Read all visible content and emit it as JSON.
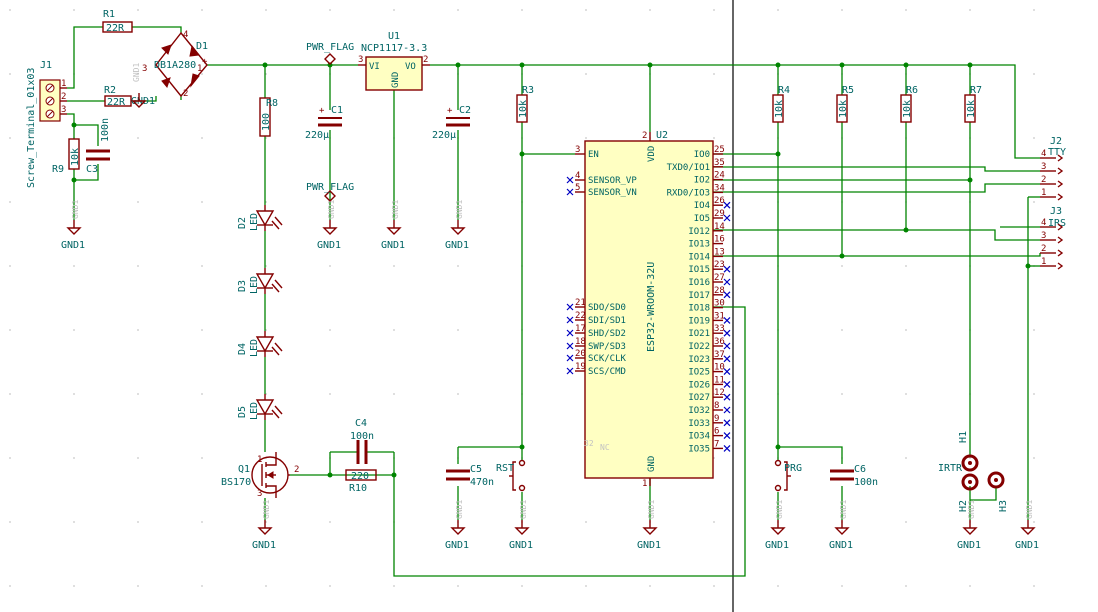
{
  "components": {
    "J1": {
      "ref": "J1",
      "value": "Screw_Terminal_01x03",
      "pins": [
        "1",
        "2",
        "3"
      ]
    },
    "R1": {
      "ref": "R1",
      "value": "22R"
    },
    "R2": {
      "ref": "R2",
      "value": "22R"
    },
    "D1": {
      "ref": "D1",
      "value": "DB1A280"
    },
    "R9": {
      "ref": "R9",
      "value": "10k"
    },
    "C3": {
      "ref": "C3",
      "value": "100n"
    },
    "R8": {
      "ref": "R8",
      "value": "100"
    },
    "C1": {
      "ref": "C1",
      "value": "220µ"
    },
    "U1": {
      "ref": "U1",
      "value": "NCP1117-3.3",
      "pin_vi": "VI",
      "pin_vo": "VO",
      "pin_gnd": "GND",
      "num_3": "3",
      "num_2": "2",
      "num_1": "1"
    },
    "C2": {
      "ref": "C2",
      "value": "220µ"
    },
    "R3": {
      "ref": "R3",
      "value": "10k"
    },
    "R4": {
      "ref": "R4",
      "value": "10k"
    },
    "R5": {
      "ref": "R5",
      "value": "10k"
    },
    "R6": {
      "ref": "R6",
      "value": "10k"
    },
    "R7": {
      "ref": "R7",
      "value": "10k"
    },
    "D2": {
      "ref": "D2",
      "value": "LED"
    },
    "D3": {
      "ref": "D3",
      "value": "LED"
    },
    "D4": {
      "ref": "D4",
      "value": "LED"
    },
    "D5": {
      "ref": "D5",
      "value": "LED"
    },
    "Q1": {
      "ref": "Q1",
      "value": "BS170",
      "pin1": "1",
      "pin2": "2",
      "pin3": "3"
    },
    "C4": {
      "ref": "C4",
      "value": "100n"
    },
    "R10": {
      "ref": "R10",
      "value": "220"
    },
    "C5": {
      "ref": "C5",
      "value": "470n"
    },
    "RST": {
      "ref": "RST"
    },
    "PRG": {
      "ref": "PRG"
    },
    "C6": {
      "ref": "C6",
      "value": "100n"
    },
    "U2": {
      "ref": "U2",
      "value": "ESP32-WROOM-32U",
      "nc": "NC",
      "nc_num": "32",
      "vdd": "VDD",
      "vdd_num": "2",
      "gnd": "GND",
      "gnd_num": "1"
    },
    "J2": {
      "ref": "J2",
      "value": "TTY",
      "pins": [
        "4",
        "3",
        "2",
        "1"
      ]
    },
    "J3": {
      "ref": "J3",
      "value": "IRS",
      "pins": [
        "4",
        "3",
        "2",
        "1"
      ]
    },
    "H1": {
      "ref": "H1"
    },
    "H2": {
      "ref": "H2"
    },
    "H3": {
      "ref": "H3"
    },
    "IRTR": {
      "ref": "IRTR"
    }
  },
  "flags": {
    "pwr1": "PWR_FLAG",
    "pwr2": "PWR_FLAG"
  },
  "gnd_label": "GND1",
  "net_labels": {
    "gnd_bridge": "GND1",
    "d1_plus": "+",
    "d1_minus": "-",
    "d1_4": "4",
    "d1_2": "2",
    "d1_3": "3",
    "d1_1": "1"
  },
  "esp_left_pins": [
    {
      "name": "EN",
      "num": "3"
    },
    {
      "name": "SENSOR_VP",
      "num": "4"
    },
    {
      "name": "SENSOR_VN",
      "num": "5"
    },
    {
      "name": "SDO/SD0",
      "num": "21"
    },
    {
      "name": "SDI/SD1",
      "num": "22"
    },
    {
      "name": "SHD/SD2",
      "num": "17"
    },
    {
      "name": "SWP/SD3",
      "num": "18"
    },
    {
      "name": "SCK/CLK",
      "num": "20"
    },
    {
      "name": "SCS/CMD",
      "num": "19"
    }
  ],
  "esp_right_pins": [
    {
      "name": "IO0",
      "num": "25"
    },
    {
      "name": "TXD0/IO1",
      "num": "35"
    },
    {
      "name": "IO2",
      "num": "24"
    },
    {
      "name": "RXD0/IO3",
      "num": "34"
    },
    {
      "name": "IO4",
      "num": "26"
    },
    {
      "name": "IO5",
      "num": "29"
    },
    {
      "name": "IO12",
      "num": "14"
    },
    {
      "name": "IO13",
      "num": "16"
    },
    {
      "name": "IO14",
      "num": "13"
    },
    {
      "name": "IO15",
      "num": "23"
    },
    {
      "name": "IO16",
      "num": "27"
    },
    {
      "name": "IO17",
      "num": "28"
    },
    {
      "name": "IO18",
      "num": "30"
    },
    {
      "name": "IO19",
      "num": "31"
    },
    {
      "name": "IO21",
      "num": "33"
    },
    {
      "name": "IO22",
      "num": "36"
    },
    {
      "name": "IO23",
      "num": "37"
    },
    {
      "name": "IO25",
      "num": "10"
    },
    {
      "name": "IO26",
      "num": "11"
    },
    {
      "name": "IO27",
      "num": "12"
    },
    {
      "name": "IO32",
      "num": "8"
    },
    {
      "name": "IO33",
      "num": "9"
    },
    {
      "name": "IO34",
      "num": "6"
    },
    {
      "name": "IO35",
      "num": "7"
    }
  ]
}
